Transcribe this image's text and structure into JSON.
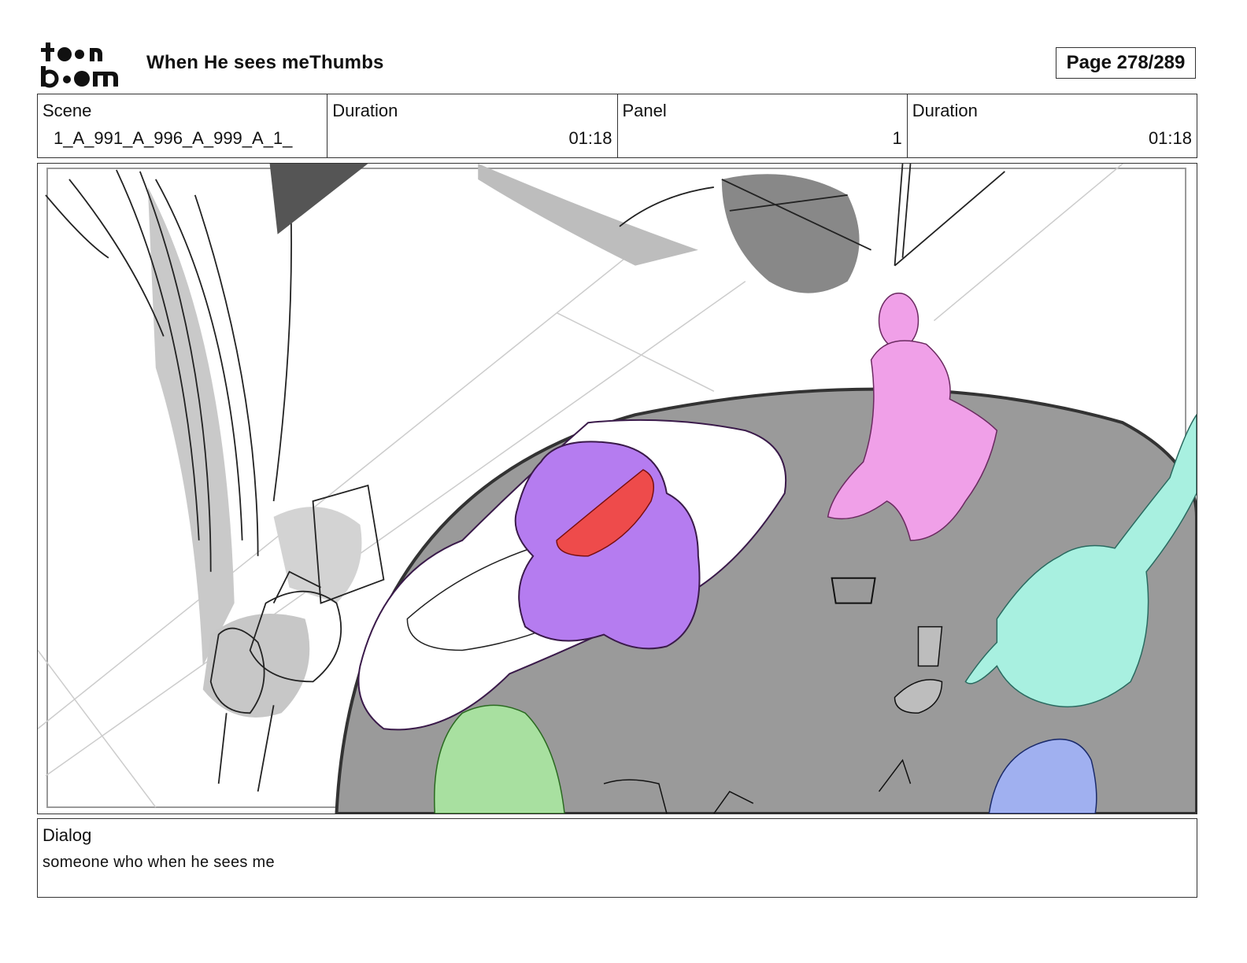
{
  "header": {
    "logo_text": "toon boom",
    "project_title": "When He sees meThumbs",
    "page_label": "Page 278/289"
  },
  "info": {
    "scene_label": "Scene",
    "scene_value": "1_A_991_A_996_A_999_A_1_",
    "scene_duration_label": "Duration",
    "scene_duration_value": "01:18",
    "panel_label": "Panel",
    "panel_value": "1",
    "panel_duration_label": "Duration",
    "panel_duration_value": "01:18"
  },
  "dialog": {
    "label": "Dialog",
    "text": "someone who when he sees me"
  },
  "colors": {
    "border": "#333333",
    "floor_gray": "#999999",
    "purple_character": "#b57cf0",
    "pink_character": "#f0a0e8",
    "teal_character": "#a8f0e0",
    "green_character": "#a8e0a0",
    "blue_character": "#a0b0f0",
    "red_object": "#ee4b4b"
  }
}
